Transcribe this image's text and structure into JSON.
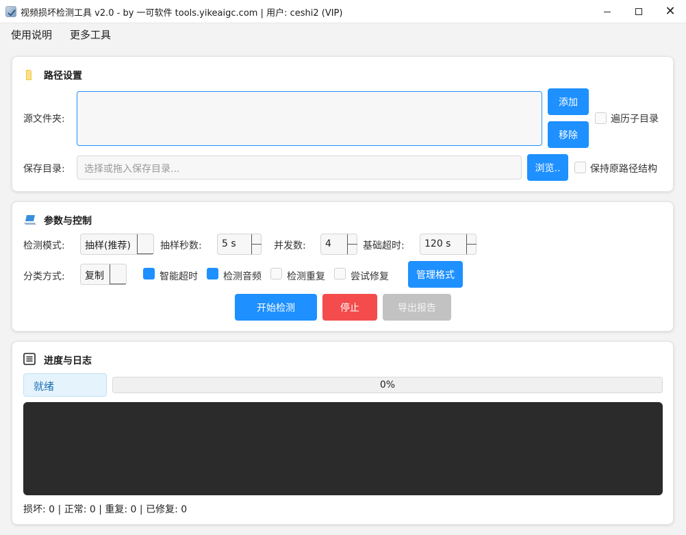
{
  "window": {
    "title": "视频损坏检测工具 v2.0 - by 一可软件 tools.yikeaigc.com | 用户: ceshi2 (VIP)",
    "min_icon": "minimize-icon",
    "max_icon": "maximize-icon",
    "close_icon": "close-icon"
  },
  "menu": {
    "items": [
      "使用说明",
      "更多工具"
    ]
  },
  "path_section": {
    "title": "路径设置",
    "icon": "folder-icon",
    "source_label": "源文件夹:",
    "add_label": "添加",
    "remove_label": "移除",
    "recurse_label": "遍历子目录",
    "recurse_checked": false,
    "save_label": "保存目录:",
    "save_placeholder": "选择或拖入保存目录...",
    "browse_label": "浏览..",
    "keep_structure_label": "保持原路径结构",
    "keep_structure_checked": false
  },
  "params_section": {
    "title": "参数与控制",
    "icon": "laptop-icon",
    "mode_label": "检测模式:",
    "mode_value": "抽样(推荐)",
    "sample_label": "抽样秒数:",
    "sample_value": "5 s",
    "concurrency_label": "并发数:",
    "concurrency_value": "4",
    "timeout_label": "基础超时:",
    "timeout_value": "120 s",
    "classify_label": "分类方式:",
    "classify_value": "复制",
    "options": [
      {
        "label": "智能超时",
        "checked": true
      },
      {
        "label": "检测音频",
        "checked": true
      },
      {
        "label": "检测重复",
        "checked": false
      },
      {
        "label": "尝试修复",
        "checked": false
      }
    ],
    "manage_formats_label": "管理格式",
    "start_label": "开始检测",
    "stop_label": "停止",
    "export_label": "导出报告"
  },
  "progress_section": {
    "title": "进度与日志",
    "icon": "document-list-icon",
    "status_text": "就绪",
    "progress_text": "0%",
    "progress_fraction": 0,
    "stats_text": "损坏: 0 | 正常: 0 | 重复: 0 | 已修复: 0"
  },
  "colors": {
    "accent": "#1e90ff",
    "danger": "#f44c4c",
    "disabled": "#c2c2c2",
    "log_bg": "#2b2b2b"
  }
}
